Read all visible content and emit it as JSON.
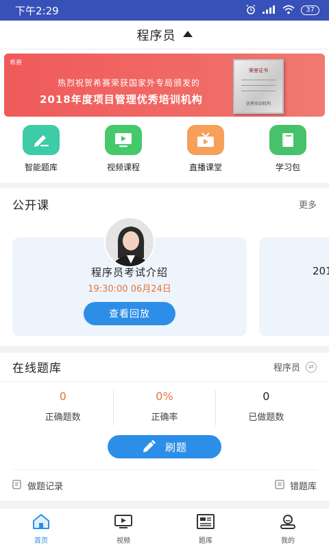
{
  "status_bar": {
    "time": "下午2:29",
    "battery": "37"
  },
  "header": {
    "title": "程序员"
  },
  "banner": {
    "logo": "希赛",
    "line1": "热烈祝贺希赛荣获国家外专局颁发的",
    "line2": "2018年度项目管理优秀培训机构",
    "cert_title": "荣誉证书",
    "cert_text": "优秀培训机构"
  },
  "menu": [
    {
      "label": "智能题库",
      "color": "#3ecba8",
      "icon": "pencil-icon"
    },
    {
      "label": "视频课程",
      "color": "#45c96b",
      "icon": "video-screen-icon"
    },
    {
      "label": "直播课堂",
      "color": "#f6a05a",
      "icon": "tv-icon"
    },
    {
      "label": "学习包",
      "color": "#47c26a",
      "icon": "book-icon"
    }
  ],
  "open_course": {
    "title": "公开课",
    "more": "更多",
    "card": {
      "name": "程序员考试介绍",
      "time": "19:30:00  06月24日",
      "button": "查看回放"
    },
    "next_card_text": "201"
  },
  "question_bank": {
    "title": "在线题库",
    "category": "程序员",
    "stats": [
      {
        "value": "0",
        "label": "正确题数",
        "color": "#e4743a"
      },
      {
        "value": "0%",
        "label": "正确率",
        "color": "#e4743a"
      },
      {
        "value": "0",
        "label": "已做题数",
        "color": "#222222"
      }
    ],
    "practice_button": "刷题",
    "record_link": "做题记录",
    "wrong_link": "错题库"
  },
  "tabs": [
    {
      "label": "首页",
      "icon": "home-icon",
      "active": true
    },
    {
      "label": "视频",
      "icon": "video-icon",
      "active": false
    },
    {
      "label": "题库",
      "icon": "question-bank-icon",
      "active": false
    },
    {
      "label": "我的",
      "icon": "profile-icon",
      "active": false
    }
  ],
  "colors": {
    "status_bar": "#3851b8",
    "accent": "#2d8ee8",
    "orange": "#e4743a"
  }
}
